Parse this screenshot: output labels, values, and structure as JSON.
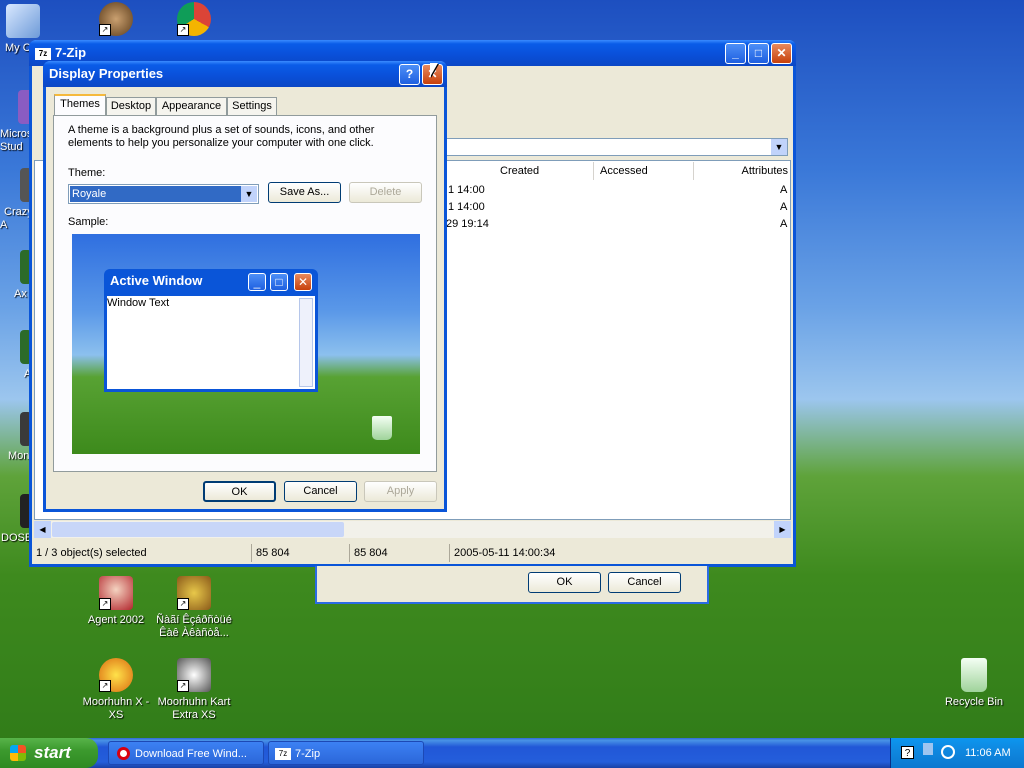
{
  "colors": {
    "xp_blue": "#0a55d8",
    "window_face": "#ece9d8",
    "close_red": "#c7400b"
  },
  "desktop": {
    "icons": [
      {
        "label": "My C",
        "icon": "my-computer-icon"
      },
      {
        "label": "",
        "icon": "raccoon-shortcut-icon"
      },
      {
        "label": "",
        "icon": "chrome-icon"
      },
      {
        "label": "Micros\nStud",
        "icon": "visual-studio-icon"
      },
      {
        "label": "Crazy\nA",
        "icon": "game-icon"
      },
      {
        "label": "Ax",
        "icon": "app-icon"
      },
      {
        "label": "A",
        "icon": "app-icon"
      },
      {
        "label": "Mon",
        "icon": "app-icon"
      },
      {
        "label": "DOSB",
        "icon": "dosbox-icon"
      },
      {
        "label": "Agent 2002",
        "icon": "agent-icon"
      },
      {
        "label": "Ñàãí Êçáðñòüé Êàê Àêàñòå...",
        "icon": "game-icon"
      },
      {
        "label": "Moorhuhn X - XS",
        "icon": "chicken-icon"
      },
      {
        "label": "Moorhuhn Kart Extra XS",
        "icon": "chicken-kart-icon"
      },
      {
        "label": "Recycle Bin",
        "icon": "recycle-bin-icon"
      }
    ]
  },
  "zip_window": {
    "title": "7-Zip",
    "columns": [
      "Created",
      "Accessed",
      "Attributes"
    ],
    "rows": [
      {
        "created": "1 14:00",
        "attr": "A"
      },
      {
        "created": "1 14:00",
        "attr": "A"
      },
      {
        "created": "29 19:14",
        "attr": "A"
      }
    ],
    "status": [
      "1 / 3 object(s) selected",
      "85 804",
      "85 804",
      "2005-05-11 14:00:34"
    ],
    "ok_label": "OK",
    "cancel_label": "Cancel"
  },
  "display_props": {
    "title": "Display Properties",
    "help_btn": "?",
    "tabs": [
      "Themes",
      "Desktop",
      "Appearance",
      "Settings"
    ],
    "description": "A theme is a background plus a set of sounds, icons, and other elements to help you personalize your computer with one click.",
    "theme_label": "Theme:",
    "theme_value": "Royale",
    "save_as": "Save As...",
    "delete": "Delete",
    "sample_label": "Sample:",
    "sample_window_title": "Active Window",
    "sample_window_text": "Window Text",
    "ok": "OK",
    "cancel": "Cancel",
    "apply": "Apply"
  },
  "taskbar": {
    "start": "start",
    "tasks": [
      {
        "label": "Download Free Wind...",
        "icon": "opera-icon"
      },
      {
        "label": "7-Zip",
        "icon": "7zip-icon"
      }
    ],
    "clock": "11:06 AM"
  }
}
